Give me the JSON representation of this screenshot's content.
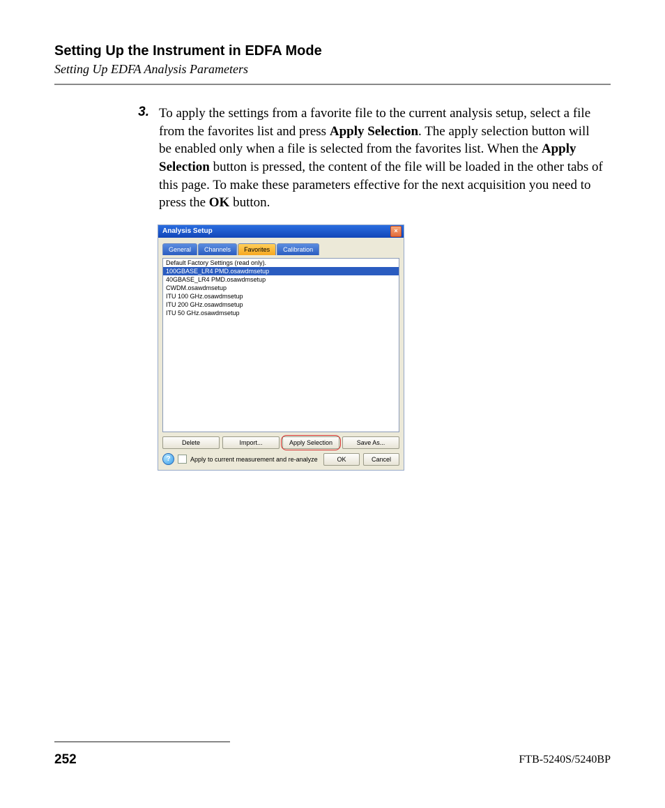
{
  "header": {
    "title": "Setting Up the Instrument in EDFA Mode",
    "subtitle": "Setting Up EDFA Analysis Parameters"
  },
  "step": {
    "number": "3.",
    "text_a": "To apply the settings from a favorite file to the current analysis setup, select a file from the favorites list and press ",
    "bold_a": "Apply Selection",
    "text_b": ". The apply selection button will be enabled only when a file is selected from the favorites list. When the ",
    "bold_b": "Apply Selection",
    "text_c": " button is pressed, the content of the file will be loaded in the other tabs of this page. To make these parameters effective for the next acquisition you need to press the ",
    "bold_c": "OK",
    "text_d": " button."
  },
  "dialog": {
    "title": "Analysis Setup",
    "close_glyph": "×",
    "tabs": [
      "General",
      "Channels",
      "Favorites",
      "Calibration"
    ],
    "list": [
      "Default Factory Settings (read only).",
      "100GBASE_LR4 PMD.osawdmsetup",
      "40GBASE_LR4 PMD.osawdmsetup",
      "CWDM.osawdmsetup",
      "ITU 100 GHz.osawdmsetup",
      "ITU 200 GHz.osawdmsetup",
      "ITU 50 GHz.osawdmsetup"
    ],
    "selected_index": 1,
    "buttons": {
      "delete": "Delete",
      "import": "Import...",
      "apply": "Apply Selection",
      "saveas": "Save As..."
    },
    "help_glyph": "?",
    "checkbox_label": "Apply to current measurement and re-analyze",
    "ok": "OK",
    "cancel": "Cancel"
  },
  "footer": {
    "page": "252",
    "model": "FTB-5240S/5240BP"
  }
}
